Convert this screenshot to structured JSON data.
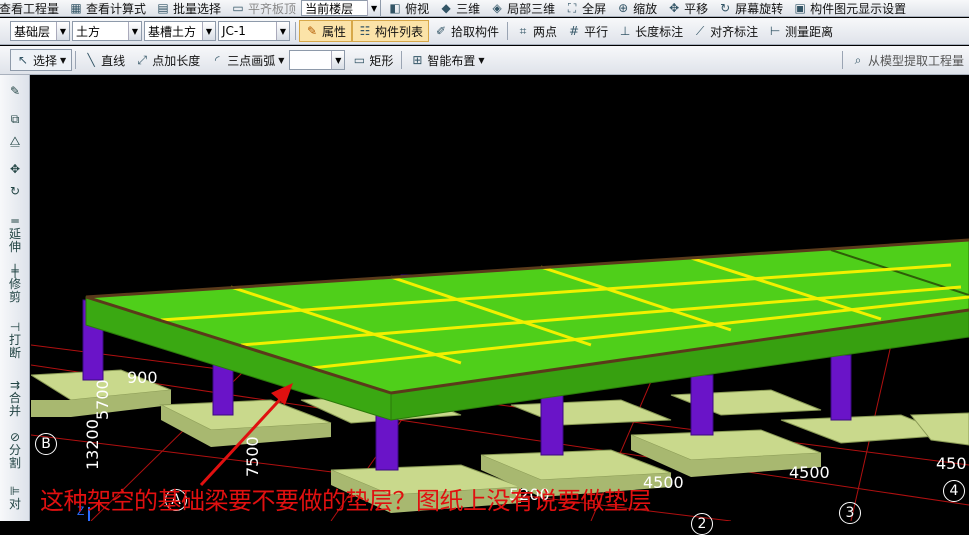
{
  "toolbar_top": {
    "items": [
      "查看工程量",
      "查看计算式",
      "批量选择",
      "平齐板顶",
      "当前楼层",
      "俯视",
      "三维",
      "局部三维",
      "全屏",
      "缩放",
      "平移",
      "屏幕旋转",
      "构件图元显示设置"
    ]
  },
  "toolbar_main": {
    "floor_select": "基础层",
    "category_select": "土方",
    "type_select": "基槽土方",
    "component_select": "JC-1",
    "properties_label": "属性",
    "component_list_label": "构件列表",
    "pick_component_label": "拾取构件",
    "two_points_label": "两点",
    "parallel_label": "平行",
    "length_mark_label": "长度标注",
    "align_mark_label": "对齐标注",
    "measure_label": "测量距离"
  },
  "toolbar_draw": {
    "select_label": "选择",
    "line_label": "直线",
    "point_length_label": "点加长度",
    "arc_label": "三点画弧",
    "arc_select_value": "",
    "rect_label": "矩形",
    "smart_layout_label": "智能布置",
    "extract_label": "从模型提取工程量"
  },
  "sidebar": {
    "items": [
      "延伸",
      "修剪",
      "打断",
      "合并",
      "分割",
      "对"
    ]
  },
  "viewport": {
    "caption": "这种架空的基础梁要不要做的垫层？图纸上没有说要做垫层",
    "dimensions": [
      "13200",
      "5700",
      "7500",
      "4500",
      "4500",
      "5200",
      "450",
      "900"
    ],
    "axis_labels": [
      "A",
      "B",
      "3",
      "4",
      "2"
    ]
  }
}
